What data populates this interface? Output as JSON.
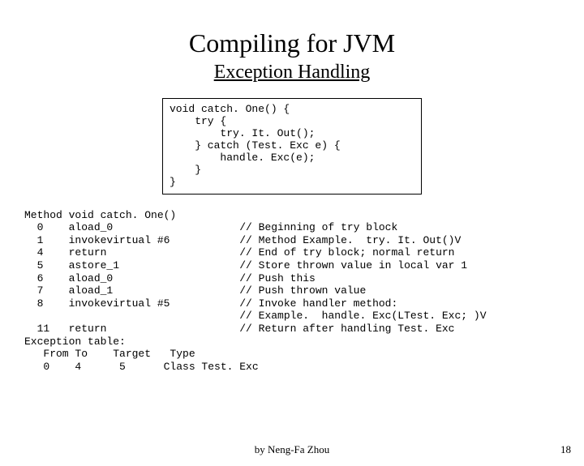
{
  "title": "Compiling for JVM",
  "subtitle": "Exception Handling",
  "source_code": "void catch. One() {\n    try {\n        try. It. Out();\n    } catch (Test. Exc e) {\n        handle. Exc(e);\n    }\n}",
  "bytecode": "Method void catch. One()\n  0    aload_0                    // Beginning of try block\n  1    invokevirtual #6           // Method Example.  try. It. Out()V\n  4    return                     // End of try block; normal return\n  5    astore_1                   // Store thrown value in local var 1\n  6    aload_0                    // Push this\n  7    aload_1                    // Push thrown value\n  8    invokevirtual #5           // Invoke handler method:\n                                  // Example.  handle. Exc(LTest. Exc; )V\n  11   return                     // Return after handling Test. Exc\nException table:\n   From To    Target   Type\n   0    4      5      Class Test. Exc",
  "author": "by Neng-Fa Zhou",
  "page_number": "18"
}
